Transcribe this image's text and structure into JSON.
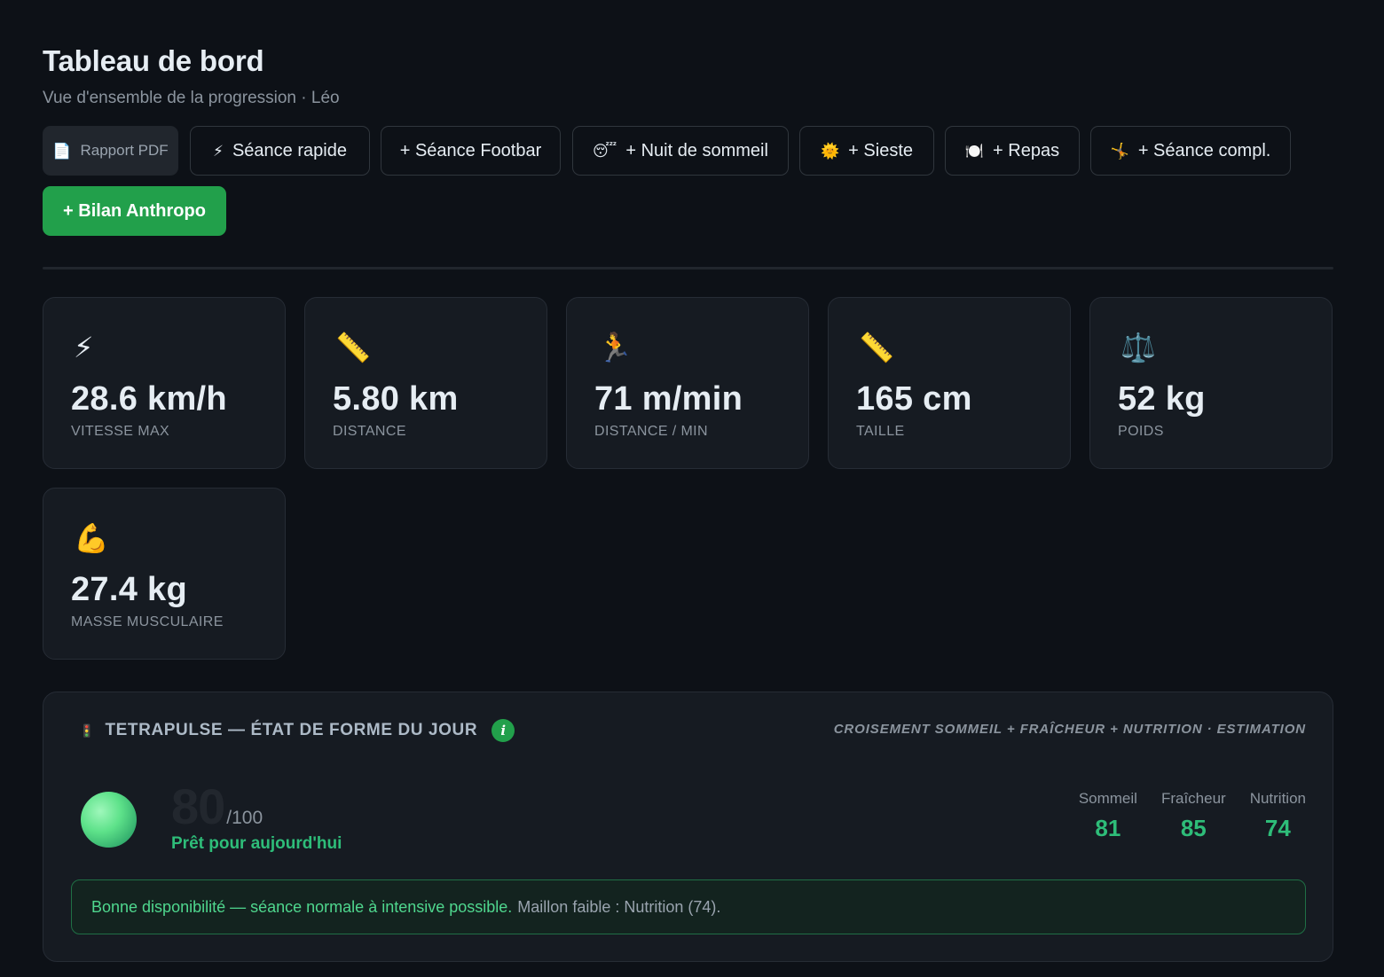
{
  "header": {
    "title": "Tableau de bord",
    "subtitle": "Vue d'ensemble de la progression · Léo"
  },
  "actions": [
    {
      "icon": "document-icon",
      "glyph": "📄",
      "label": "Rapport PDF"
    },
    {
      "icon": "lightning-icon",
      "glyph": "⚡",
      "label": "Séance rapide"
    },
    {
      "icon": "",
      "glyph": "",
      "label": "+ Séance Footbar"
    },
    {
      "icon": "sleeping-face-icon",
      "glyph": "😴",
      "label": "+ Nuit de sommeil"
    },
    {
      "icon": "sun-icon",
      "glyph": "🌞",
      "label": "+ Sieste"
    },
    {
      "icon": "plate-icon",
      "glyph": "🍽️",
      "label": "+ Repas"
    },
    {
      "icon": "cartwheel-icon",
      "glyph": "🤸",
      "label": "+ Séance compl."
    },
    {
      "icon": "",
      "glyph": "",
      "label": "+ Bilan Anthropo"
    }
  ],
  "stats": [
    {
      "icon": "lightning-icon",
      "glyph": "⚡",
      "value": "28.6 km/h",
      "label": "VITESSE MAX"
    },
    {
      "icon": "ruler-icon",
      "glyph": "📏",
      "value": "5.80 km",
      "label": "DISTANCE"
    },
    {
      "icon": "runner-icon",
      "glyph": "🏃",
      "value": "71 m/min",
      "label": "DISTANCE / MIN"
    },
    {
      "icon": "ruler-icon",
      "glyph": "📏",
      "value": "165 cm",
      "label": "TAILLE"
    },
    {
      "icon": "balance-scale-icon",
      "glyph": "⚖️",
      "value": "52 kg",
      "label": "POIDS"
    },
    {
      "icon": "flexed-biceps-icon",
      "glyph": "💪",
      "value": "27.4 kg",
      "label": "MASSE MUSCULAIRE"
    }
  ],
  "tetrapulse": {
    "icon_glyph": "🚦",
    "title": "TETRAPULSE — ÉTAT DE FORME DU JOUR",
    "info": "i",
    "note": "CROISEMENT SOMMEIL + FRAÎCHEUR + NUTRITION · ESTIMATION",
    "score": "80",
    "score_max": "/100",
    "status": "Prêt pour aujourd'hui",
    "metrics": [
      {
        "label": "Sommeil",
        "value": "81"
      },
      {
        "label": "Fraîcheur",
        "value": "85"
      },
      {
        "label": "Nutrition",
        "value": "74"
      }
    ],
    "advice_main": "Bonne disponibilité — séance normale à intensive possible.",
    "advice_sub": "Maillon faible : Nutrition (74)."
  },
  "colors": {
    "background": "#0d1117",
    "card": "#161b22",
    "accent_green": "#22a04b",
    "metric_green": "#2ebd79"
  }
}
